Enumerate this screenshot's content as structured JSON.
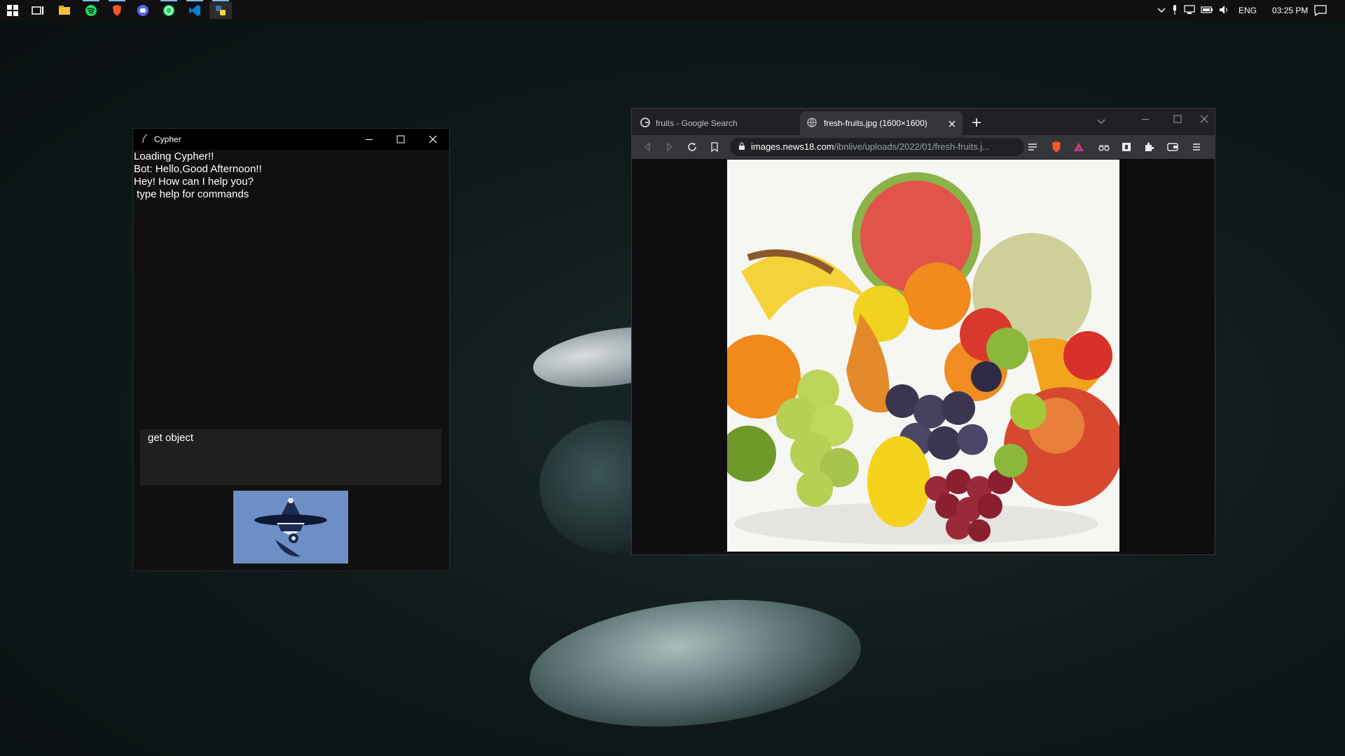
{
  "taskbar": {
    "apps": [
      "start-icon",
      "task-view-icon",
      "file-explorer-icon",
      "spotify-icon",
      "brave-icon",
      "discord-icon",
      "whatsapp-icon",
      "vscode-icon",
      "python-icon"
    ],
    "tray": {
      "language": "ENG",
      "time": "03:25 PM"
    }
  },
  "cypher": {
    "title": "Cypher",
    "log": [
      "Loading Cypher!!",
      "Bot: Hello,Good Afternoon!!",
      "Hey! How can I help you?",
      " type help for commands"
    ],
    "input_value": "get object"
  },
  "browser": {
    "tabs": [
      {
        "label": "fruits - Google Search",
        "active": false
      },
      {
        "label": "fresh-fruits.jpg (1600×1600)",
        "active": true
      }
    ],
    "url_domain": "images.news18.com",
    "url_path": "/ibnlive/uploads/2022/01/fresh-fruits.j...",
    "image_alt_icon": "fruit-image"
  },
  "colors": {
    "accent": "#7fb6e0",
    "brave": "#fb542b",
    "avatar_bg": "#6e8fc6"
  }
}
